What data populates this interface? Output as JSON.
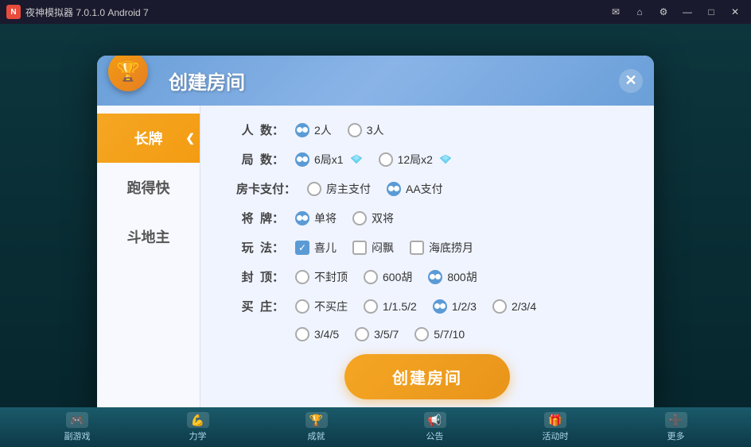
{
  "titlebar": {
    "logo": "NOX",
    "appname": "夜神模拟器 7.0.1.0  Android 7",
    "controls": {
      "minimize": "—",
      "maximize": "□",
      "close": "✕",
      "settings": "⚙",
      "home": "⌂",
      "message": "✉"
    }
  },
  "dialog": {
    "title": "创建房间",
    "close_label": "✕",
    "icon_emoji": "🏆"
  },
  "sidebar": {
    "items": [
      {
        "id": "changpai",
        "label": "长牌",
        "active": true
      },
      {
        "id": "paodekuai",
        "label": "跑得快",
        "active": false
      },
      {
        "id": "doudizhu",
        "label": "斗地主",
        "active": false
      }
    ]
  },
  "form": {
    "rows": [
      {
        "label": "人  数：",
        "type": "radio",
        "options": [
          {
            "label": "2人",
            "selected": true,
            "gem": false
          },
          {
            "label": "3人",
            "selected": false,
            "gem": false
          }
        ]
      },
      {
        "label": "局  数：",
        "type": "radio",
        "options": [
          {
            "label": "6局x1",
            "selected": true,
            "gem": true
          },
          {
            "label": "12局x2",
            "selected": false,
            "gem": true
          }
        ]
      },
      {
        "label": "房卡支付：",
        "type": "radio",
        "options": [
          {
            "label": "房主支付",
            "selected": false,
            "gem": false
          },
          {
            "label": "AA支付",
            "selected": true,
            "gem": false
          }
        ]
      },
      {
        "label": "将  牌：",
        "type": "radio",
        "options": [
          {
            "label": "单将",
            "selected": true,
            "gem": false
          },
          {
            "label": "双将",
            "selected": false,
            "gem": false
          }
        ]
      },
      {
        "label": "玩  法：",
        "type": "checkbox",
        "options": [
          {
            "label": "喜儿",
            "checked": true
          },
          {
            "label": "闷飘",
            "checked": false
          },
          {
            "label": "海底捞月",
            "checked": false
          }
        ]
      },
      {
        "label": "封  顶：",
        "type": "radio",
        "options": [
          {
            "label": "不封顶",
            "selected": false,
            "gem": false
          },
          {
            "label": "600胡",
            "selected": false,
            "gem": false
          },
          {
            "label": "800胡",
            "selected": true,
            "gem": false
          }
        ]
      },
      {
        "label": "买  庄：",
        "type": "radio",
        "options": [
          {
            "label": "不买庄",
            "selected": false,
            "gem": false
          },
          {
            "label": "1/1.5/2",
            "selected": false,
            "gem": false
          },
          {
            "label": "1/2/3",
            "selected": true,
            "gem": false
          },
          {
            "label": "2/3/4",
            "selected": false,
            "gem": false
          }
        ]
      },
      {
        "label": "",
        "type": "radio",
        "options": [
          {
            "label": "3/4/5",
            "selected": false,
            "gem": false
          },
          {
            "label": "3/5/7",
            "selected": false,
            "gem": false
          },
          {
            "label": "5/7/10",
            "selected": false,
            "gem": false
          }
        ]
      }
    ],
    "create_btn_label": "创建房间"
  },
  "bottom_bar": {
    "items": [
      {
        "icon": "🎮",
        "label": "副游戏"
      },
      {
        "icon": "💪",
        "label": "力学"
      },
      {
        "icon": "🏆",
        "label": "成就"
      },
      {
        "icon": "📢",
        "label": "公告"
      },
      {
        "icon": "🎁",
        "label": "活动时"
      },
      {
        "icon": "➕",
        "label": "更多"
      }
    ]
  }
}
